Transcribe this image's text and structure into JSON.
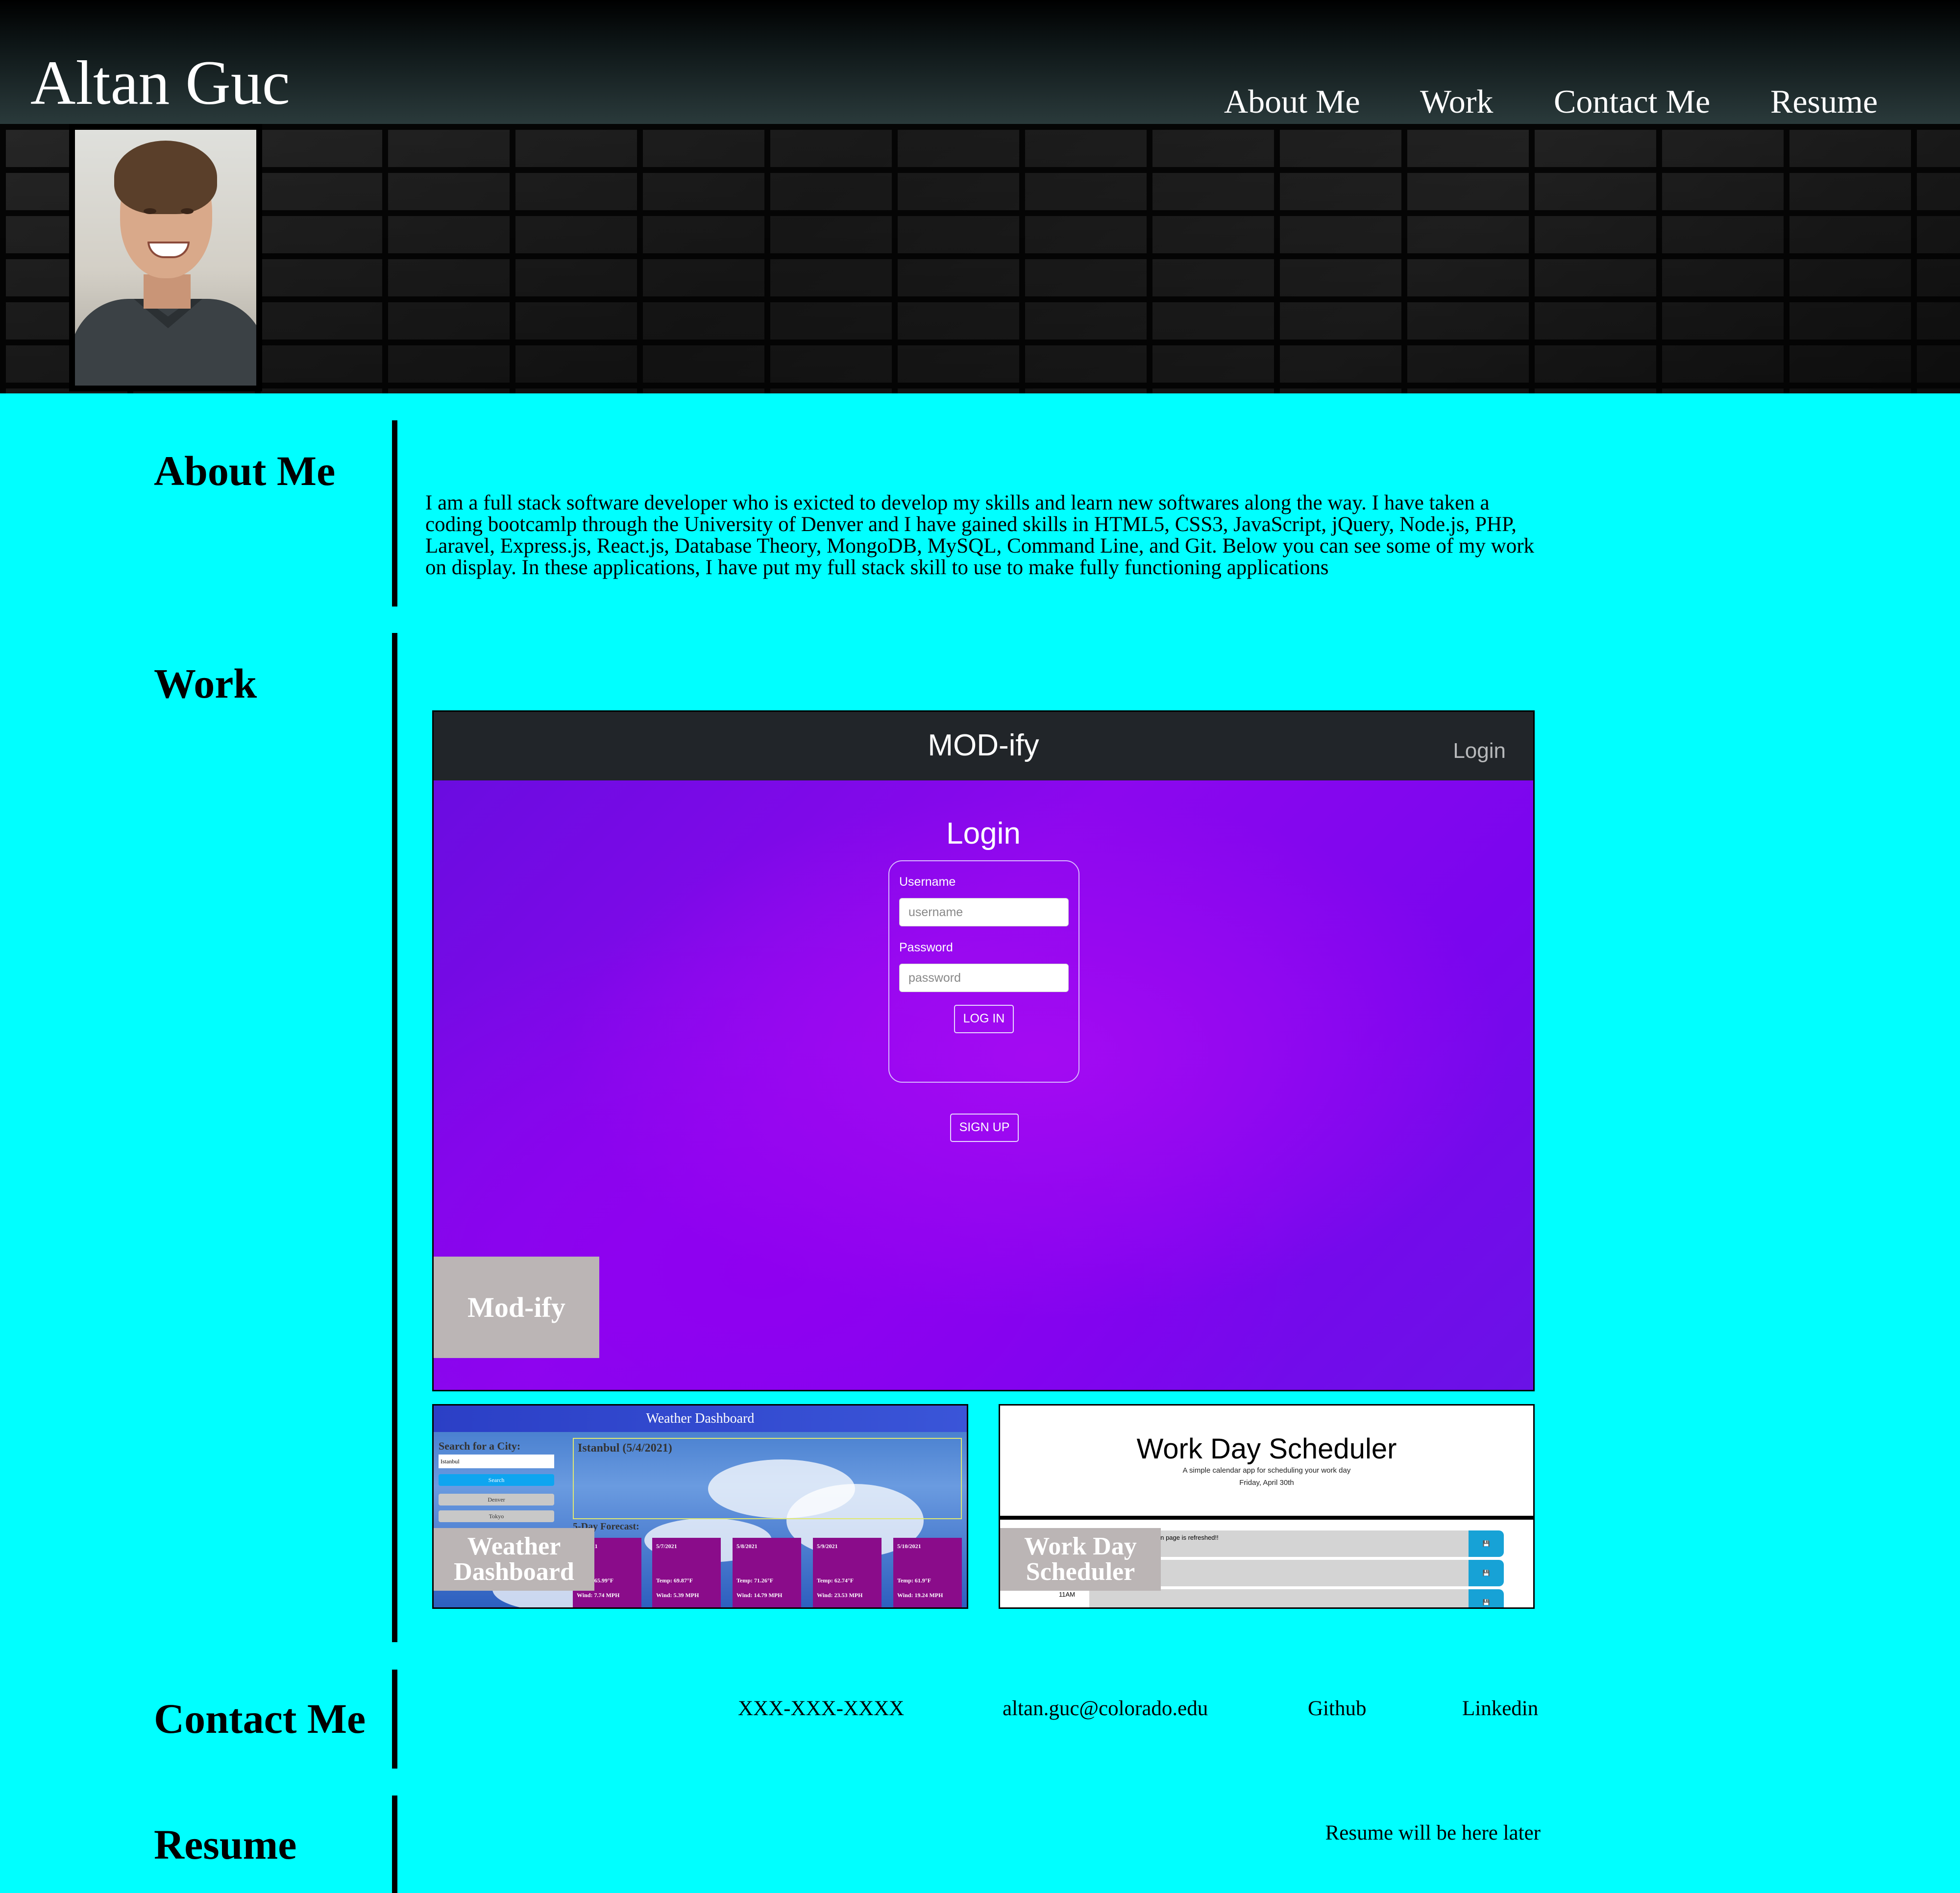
{
  "header": {
    "title": "Altan Guc",
    "nav": [
      "About Me",
      "Work",
      "Contact Me",
      "Resume"
    ]
  },
  "profile": {
    "photo": "profile photo of Altan Guc"
  },
  "about": {
    "title": "About Me",
    "text": "I am a full stack software developer who is exicted to develop my skills and learn new softwares along the way. I have taken a coding bootcamlp through the University of Denver and I have gained skills in HTML5, CSS3, JavaScript, jQuery, Node.js, PHP, Laravel, Express.js, React.js, Database Theory, MongoDB, MySQL, Command Line, and Git. Below you can see some of my work on display. In these applications, I have put my full stack skill to use to make fully functioning applications"
  },
  "work": {
    "title": "Work",
    "projects": [
      {
        "label": "Mod-ify",
        "screenshot": {
          "brand": "MOD-ify",
          "nav_link": "Login",
          "form_title": "Login",
          "username_label": "Username",
          "username_placeholder": "username",
          "password_label": "Password",
          "password_placeholder": "password",
          "login_button": "LOG IN",
          "signup_button": "SIGN UP"
        }
      },
      {
        "label": "Weather Dashboard",
        "screenshot": {
          "header": "Weather Dashboard",
          "search_label": "Search for a City:",
          "search_value": "Istanbul",
          "search_button": "Search",
          "history": [
            "Denver",
            "Tokyo"
          ],
          "current_title": "Istanbul (5/4/2021)",
          "forecast_title": "5-Day Forecast:",
          "forecast": [
            {
              "date": "5/6/2021",
              "temp": "Temp: 65.99°F",
              "wind": "Wind: 7.74 MPH"
            },
            {
              "date": "5/7/2021",
              "temp": "Temp: 69.87°F",
              "wind": "Wind: 5.39 MPH"
            },
            {
              "date": "5/8/2021",
              "temp": "Temp: 71.26°F",
              "wind": "Wind: 14.79 MPH"
            },
            {
              "date": "5/9/2021",
              "temp": "Temp: 62.74°F",
              "wind": "Wind: 23.53 MPH"
            },
            {
              "date": "5/10/2021",
              "temp": "Temp: 61.9°F",
              "wind": "Wind: 19.24 MPH"
            }
          ]
        }
      },
      {
        "label": "Work Day Scheduler",
        "screenshot": {
          "title": "Work Day Scheduler",
          "subtitle": "A simple calendar app for scheduling your work day",
          "date": "Friday, April 30th",
          "note": "en page is refreshed!!",
          "hour": "11AM"
        }
      }
    ]
  },
  "contact": {
    "title": "Contact Me",
    "phone": "XXX-XXX-XXXX",
    "email": "altan.guc@colorado.edu",
    "github": "Github",
    "linkedin": "Linkedin"
  },
  "resume": {
    "title": "Resume",
    "text": "Resume will be here later"
  }
}
